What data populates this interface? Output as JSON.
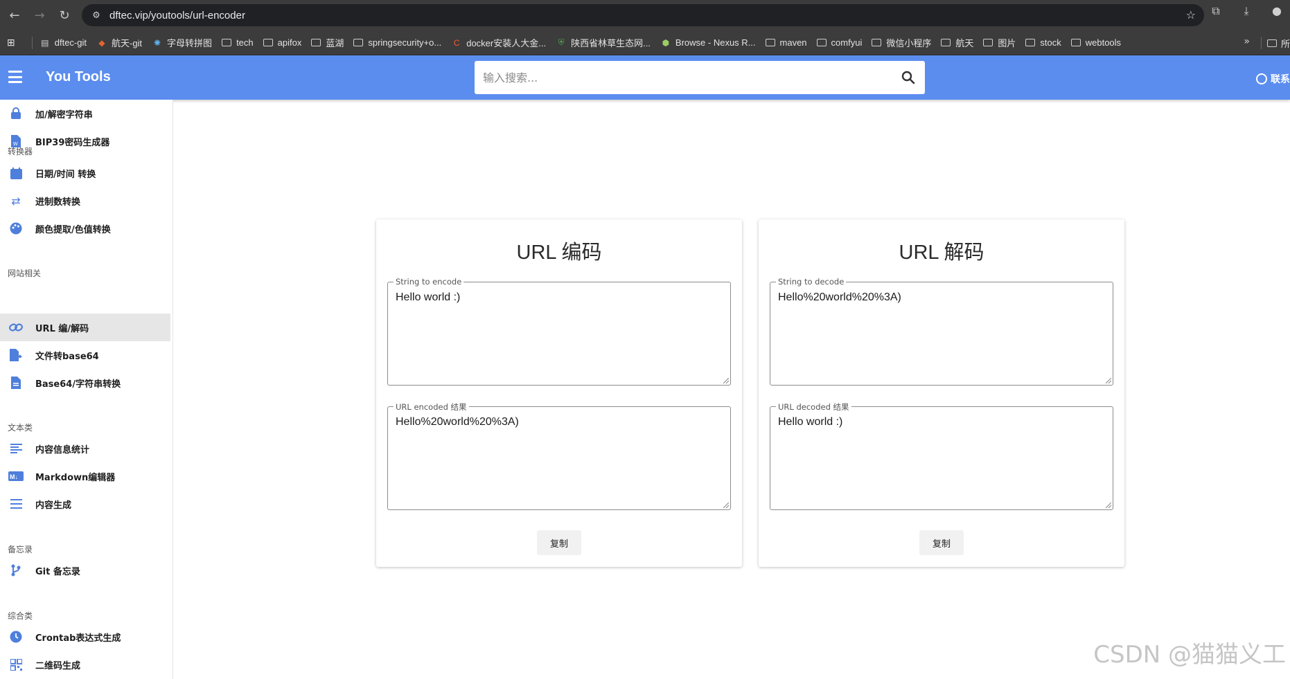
{
  "browser": {
    "url": "dftec.vip/youtools/url-encoder",
    "bookmarks": [
      {
        "label": "dftec-git",
        "icon": "page-icon"
      },
      {
        "label": "航天-git",
        "icon": "gitlab-icon"
      },
      {
        "label": "字母转拼图",
        "icon": "react-icon"
      },
      {
        "label": "tech",
        "icon": "folder-icon"
      },
      {
        "label": "apifox",
        "icon": "folder-icon"
      },
      {
        "label": "蓝湖",
        "icon": "folder-icon"
      },
      {
        "label": "springsecurity+o...",
        "icon": "folder-icon"
      },
      {
        "label": "docker安装人大金...",
        "icon": "csdn-icon"
      },
      {
        "label": "陕西省林草生态网...",
        "icon": "shield-icon"
      },
      {
        "label": "Browse - Nexus R...",
        "icon": "nexus-icon"
      },
      {
        "label": "maven",
        "icon": "folder-icon"
      },
      {
        "label": "comfyui",
        "icon": "folder-icon"
      },
      {
        "label": "微信小程序",
        "icon": "folder-icon"
      },
      {
        "label": "航天",
        "icon": "folder-icon"
      },
      {
        "label": "图片",
        "icon": "folder-icon"
      },
      {
        "label": "stock",
        "icon": "folder-icon"
      },
      {
        "label": "webtools",
        "icon": "folder-icon"
      }
    ],
    "more_label": "»",
    "last_bookmark": "所"
  },
  "app": {
    "title": "You Tools",
    "search_placeholder": "输入搜索...",
    "contact_label": "联系"
  },
  "sidebar": {
    "items_top": [
      {
        "label": "加/解密字符串",
        "icon": "lock-icon"
      },
      {
        "label": "BIP39密码生成器",
        "icon": "word-doc-icon"
      }
    ],
    "sections": [
      {
        "title": "转换器",
        "items": [
          {
            "label": "日期/时间 转换",
            "icon": "calendar-icon"
          },
          {
            "label": "进制数转换",
            "icon": "swap-icon"
          },
          {
            "label": "颜色提取/色值转换",
            "icon": "palette-icon"
          }
        ]
      },
      {
        "title": "网站相关",
        "items": [
          {
            "label": "URL 编/解码",
            "icon": "link-icon",
            "active": true
          },
          {
            "label": "文件转base64",
            "icon": "file-export-icon"
          },
          {
            "label": "Base64/字符串转换",
            "icon": "document-icon"
          }
        ]
      },
      {
        "title": "文本类",
        "items": [
          {
            "label": "内容信息统计",
            "icon": "text-align-icon"
          },
          {
            "label": "Markdown编辑器",
            "icon": "markdown-icon"
          },
          {
            "label": "内容生成",
            "icon": "list-icon"
          }
        ]
      },
      {
        "title": "备忘录",
        "items": [
          {
            "label": "Git 备忘录",
            "icon": "git-branch-icon"
          }
        ]
      },
      {
        "title": "综合类",
        "items": [
          {
            "label": "Crontab表达式生成",
            "icon": "clock-icon"
          },
          {
            "label": "二维码生成",
            "icon": "qrcode-icon"
          }
        ]
      }
    ]
  },
  "encode_card": {
    "title": "URL 编码",
    "input_label": "String to encode",
    "input_value": "Hello world :)",
    "output_label": "URL encoded 结果",
    "output_value": "Hello%20world%20%3A)",
    "copy_label": "复制"
  },
  "decode_card": {
    "title": "URL 解码",
    "input_label": "String to decode",
    "input_value": "Hello%20world%20%3A)",
    "output_label": "URL decoded 结果",
    "output_value": "Hello world :)",
    "copy_label": "复制"
  },
  "watermark": "CSDN @猫猫义工",
  "colors": {
    "appbar": "#5b8def",
    "accent_icon": "#4f7fdc"
  }
}
